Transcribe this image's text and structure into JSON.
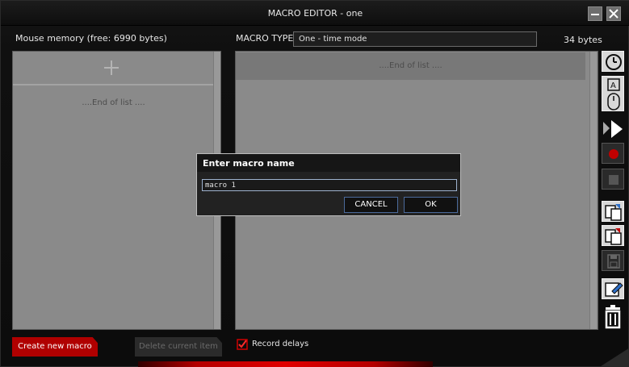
{
  "window": {
    "title": "MACRO EDITOR - one"
  },
  "memory": {
    "label": "Mouse memory (free: 6990 bytes)"
  },
  "macro_type": {
    "label": "MACRO TYPE",
    "value": "One - time mode",
    "bytes": "34 bytes"
  },
  "left_list": {
    "end_text": "....End of list ...."
  },
  "right_list": {
    "end_text": "....End of list ...."
  },
  "buttons": {
    "create": "Create new macro",
    "delete": "Delete current item"
  },
  "record": {
    "label": "Record delays",
    "checked": true
  },
  "dialog": {
    "title": "Enter macro name",
    "input_value": "macro 1",
    "cancel": "CANCEL",
    "ok": "OK"
  },
  "colors": {
    "accent": "#b00000",
    "dialog_border": "#4b6a9b"
  },
  "toolbar_icons": [
    "clock-icon",
    "keyboard-mouse-icon",
    "cursor-arrow-icon",
    "record-icon",
    "stop-icon",
    "copy-icon",
    "paste-icon",
    "save-icon",
    "edit-icon",
    "trash-icon"
  ]
}
